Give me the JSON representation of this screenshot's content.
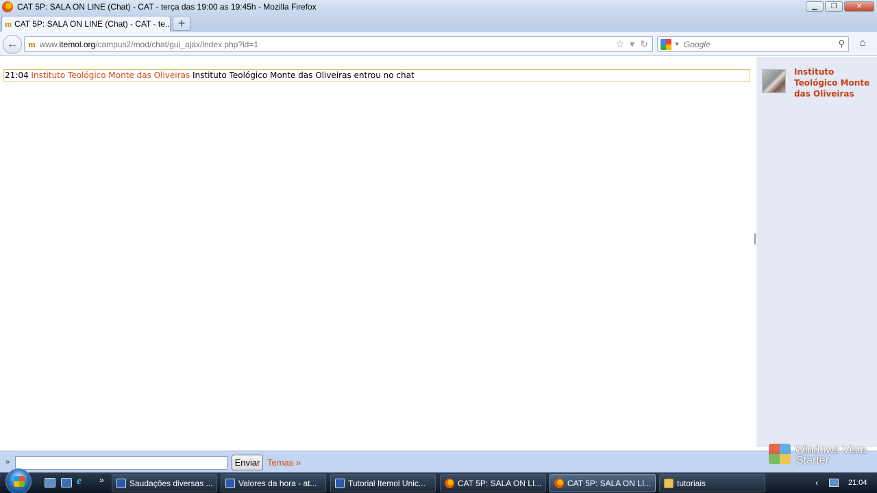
{
  "window": {
    "title": "CAT 5P: SALA ON LINE (Chat) - CAT - terça das 19:00 as 19:45h - Mozilla Firefox",
    "controls": {
      "minimize": "▁",
      "maximize": "❐",
      "close": "✕"
    }
  },
  "tabs": [
    {
      "label": "CAT 5P: SALA ON LINE (Chat) - CAT - te...",
      "favicon": "m"
    }
  ],
  "new_tab_label": "+",
  "nav": {
    "back": "←",
    "url_prefix": "www.",
    "url_domain": "itemol.org",
    "url_path": "/campus2/mod/chat/gui_ajax/index.php?id=1",
    "site_icon": "m",
    "search_placeholder": "Google",
    "star": "☆",
    "dropdown": "▾",
    "reload": "↻",
    "search_glass": "⚲",
    "home": "⌂"
  },
  "messages": [
    {
      "time": "21:04",
      "user": "Instituto Teológico Monte das Oliveiras",
      "text": "Instituto Teológico Monte das Oliveiras entrou no chat"
    }
  ],
  "users": [
    {
      "name": "Instituto Teológico Monte das Oliveiras"
    }
  ],
  "input_bar": {
    "prompt": "»",
    "send_label": "Enviar",
    "themes_label": "Temas »"
  },
  "watermark": {
    "line1": "Windows Vista",
    "line2": "Starter"
  },
  "taskbar": {
    "more": "»",
    "tasks": [
      {
        "label": "Saudações diversas ...",
        "icon": "word"
      },
      {
        "label": "Valores da hora - at...",
        "icon": "word"
      },
      {
        "label": "Tutorial Itemol Unic...",
        "icon": "word"
      },
      {
        "label": "CAT 5P: SALA ON LI...",
        "icon": "firefox"
      },
      {
        "label": "CAT 5P: SALA ON LI...",
        "icon": "firefox",
        "active": true
      },
      {
        "label": "tutoriais",
        "icon": "folder"
      }
    ],
    "tray_arrow": "‹",
    "clock": "21:04"
  },
  "colors": {
    "username": "#d44a18",
    "userlist_bg": "#e5e9f4",
    "input_bar_bg": "#c3d5f0",
    "message_border": "#d8c070"
  }
}
